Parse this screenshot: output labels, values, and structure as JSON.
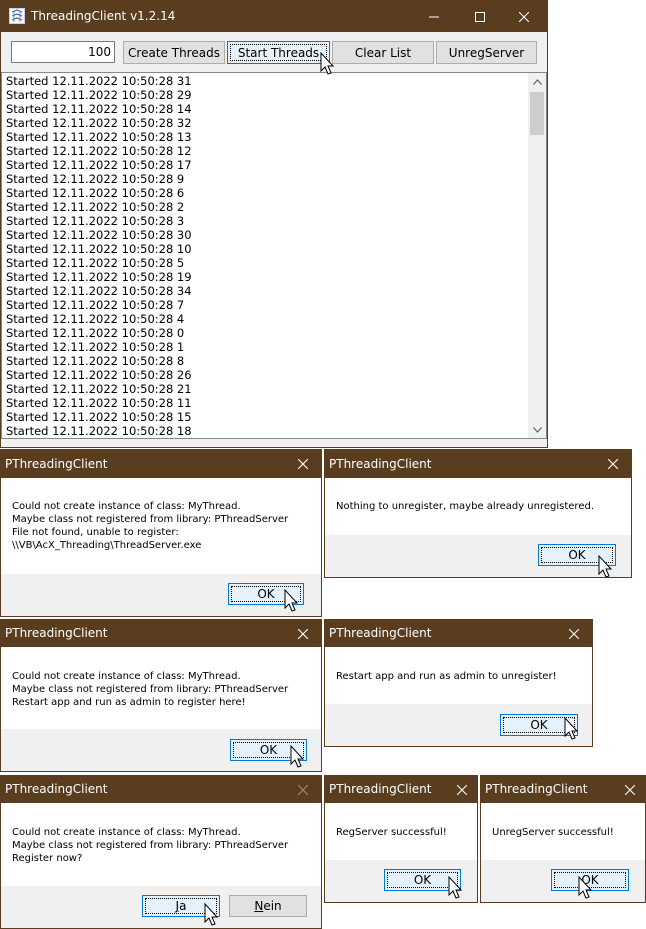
{
  "main": {
    "title": "ThreadingClient v1.2.14",
    "count_value": "100",
    "buttons": {
      "create": "Create Threads",
      "start": "Start Threads",
      "clear": "Clear List",
      "unreg": "UnregServer"
    },
    "list": [
      "Started 12.11.2022 10:50:28 31",
      "Started 12.11.2022 10:50:28 29",
      "Started 12.11.2022 10:50:28 14",
      "Started 12.11.2022 10:50:28 32",
      "Started 12.11.2022 10:50:28 13",
      "Started 12.11.2022 10:50:28 12",
      "Started 12.11.2022 10:50:28 17",
      "Started 12.11.2022 10:50:28 9",
      "Started 12.11.2022 10:50:28 6",
      "Started 12.11.2022 10:50:28 2",
      "Started 12.11.2022 10:50:28 3",
      "Started 12.11.2022 10:50:28 30",
      "Started 12.11.2022 10:50:28 10",
      "Started 12.11.2022 10:50:28 5",
      "Started 12.11.2022 10:50:28 19",
      "Started 12.11.2022 10:50:28 34",
      "Started 12.11.2022 10:50:28 7",
      "Started 12.11.2022 10:50:28 4",
      "Started 12.11.2022 10:50:28 0",
      "Started 12.11.2022 10:50:28 1",
      "Started 12.11.2022 10:50:28 8",
      "Started 12.11.2022 10:50:28 26",
      "Started 12.11.2022 10:50:28 21",
      "Started 12.11.2022 10:50:28 11",
      "Started 12.11.2022 10:50:28 15",
      "Started 12.11.2022 10:50:28 18"
    ]
  },
  "dialogs": {
    "d1": {
      "title": "PThreadingClient",
      "lines": [
        "Could not create instance of class: MyThread.",
        "Maybe class not registered from library: PThreadServer",
        "File not found, unable to register:",
        "\\\\VB\\AcX_Threading\\ThreadServer.exe"
      ],
      "ok": "OK"
    },
    "d2": {
      "title": "PThreadingClient",
      "lines": [
        "Nothing to unregister, maybe already unregistered."
      ],
      "ok": "OK"
    },
    "d3": {
      "title": "PThreadingClient",
      "lines": [
        "Could not create instance of class: MyThread.",
        "Maybe class not registered from library: PThreadServer",
        "Restart app and run as admin to register here!"
      ],
      "ok": "OK"
    },
    "d4": {
      "title": "PThreadingClient",
      "lines": [
        "Restart app and run as admin to unregister!"
      ],
      "ok": "OK"
    },
    "d5": {
      "title": "PThreadingClient",
      "lines": [
        "Could not create instance of class: MyThread.",
        "Maybe class not registered from library: PThreadServer",
        "Register now?"
      ],
      "yes_hotkey": "J",
      "yes_rest": "a",
      "no_hotkey": "N",
      "no_rest": "ein"
    },
    "d6": {
      "title": "PThreadingClient",
      "lines": [
        "RegServer successful!"
      ],
      "ok": "OK"
    },
    "d7": {
      "title": "PThreadingClient",
      "lines": [
        "UnregServer successful!"
      ],
      "ok": "OK"
    }
  },
  "icons": {
    "app": "app-icon",
    "close": "close-icon",
    "minimize": "minimize-icon",
    "maximize": "maximize-icon",
    "cursor": "mouse-cursor-icon",
    "scroll_up": "chevron-up-icon",
    "scroll_down": "chevron-down-icon"
  },
  "colors": {
    "titlebar": "#5a3c1f",
    "focus_border": "#0078d7",
    "button_face": "#e1e1e1",
    "dialog_footer": "#f0f0f0"
  }
}
